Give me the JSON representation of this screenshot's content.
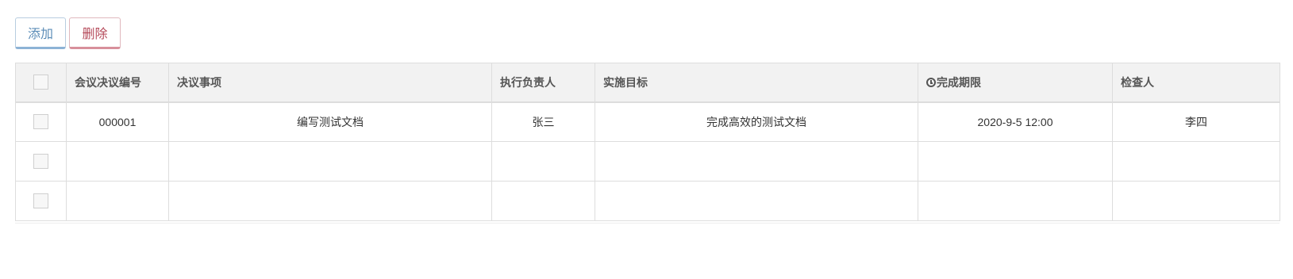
{
  "toolbar": {
    "add_label": "添加",
    "delete_label": "删除"
  },
  "table": {
    "headers": {
      "code": "会议决议编号",
      "item": "决议事项",
      "owner": "执行负责人",
      "target": "实施目标",
      "deadline": "完成期限",
      "checker": "检查人"
    },
    "rows": [
      {
        "code": "000001",
        "item": "编写测试文档",
        "owner": "张三",
        "target": "完成高效的测试文档",
        "deadline": "2020-9-5 12:00",
        "checker": "李四"
      },
      {
        "code": "",
        "item": "",
        "owner": "",
        "target": "",
        "deadline": "",
        "checker": ""
      },
      {
        "code": "",
        "item": "",
        "owner": "",
        "target": "",
        "deadline": "",
        "checker": ""
      }
    ]
  },
  "icons": {
    "deadline_header": "clock-icon"
  }
}
